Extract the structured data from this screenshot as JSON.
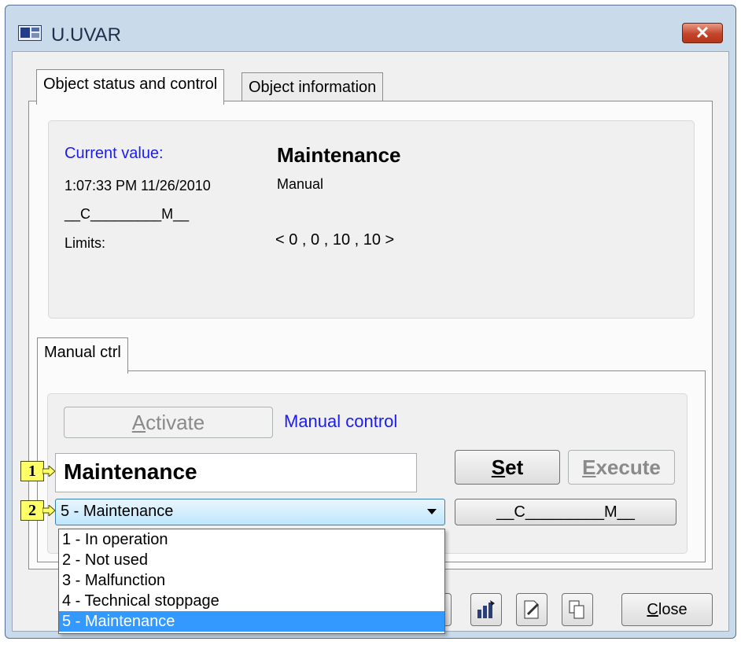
{
  "window": {
    "title": "U.UVAR",
    "close_glyph": "✕"
  },
  "tabs": [
    {
      "label": "Object status and control",
      "active": true
    },
    {
      "label": "Object information",
      "active": false
    }
  ],
  "status": {
    "current_value_label": "Current value:",
    "current_value": "Maintenance",
    "timestamp": "1:07:33 PM 11/26/2010",
    "mode": "Manual",
    "flags": "__C_________M__",
    "limits_label": "Limits:",
    "limits_value": "< 0 , 0 , 10 , 10 >"
  },
  "manual": {
    "tab_label": "Manual ctrl",
    "activate_prefix": "A",
    "activate_rest": "ctivate",
    "manual_control_label": "Manual control",
    "value_input": "Maintenance",
    "set_prefix": "S",
    "set_rest": "et",
    "execute_prefix": "E",
    "execute_rest": "xecute",
    "flags_button": "__C_________M__",
    "combo_selected": "5 - Maintenance",
    "combo_options": [
      "1 - In operation",
      "2 - Not used",
      "3 - Malfunction",
      "4 - Technical stoppage",
      "5 - Maintenance"
    ],
    "selected_index": 4
  },
  "callouts": {
    "first": "1",
    "second": "2"
  },
  "bottom": {
    "close_prefix": "C",
    "close_rest": "lose"
  },
  "icons": [
    "window-app-icon",
    "chart-icon",
    "edit-document-icon",
    "copy-icon"
  ],
  "colors": {
    "accent_blue": "#1c1cf2",
    "selection": "#3399ff",
    "callout": "#ffff66"
  }
}
